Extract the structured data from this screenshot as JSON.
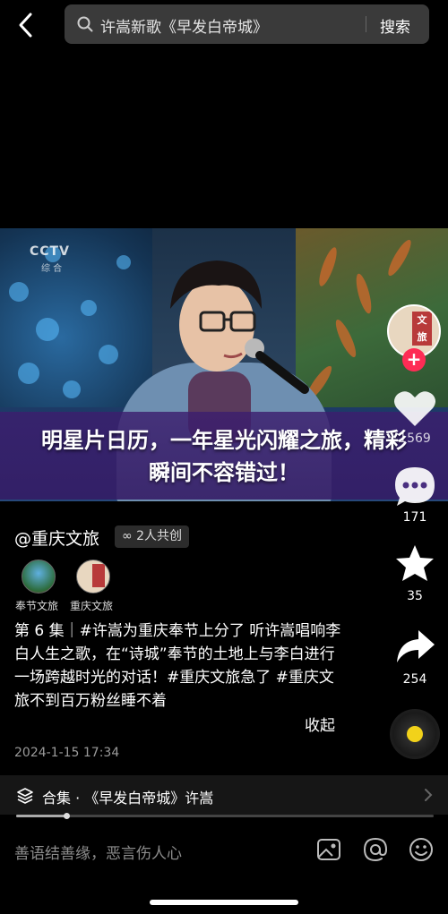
{
  "search": {
    "query": "许嵩新歌《早发白帝城》",
    "submit_label": "搜索"
  },
  "video": {
    "channel_logo": "CCTV",
    "channel_sub": "综 合",
    "banner_text": "明星片日历，一年星光闪耀之旅，精彩瞬间不容错过！"
  },
  "rail": {
    "avatar_badge": [
      "文",
      "旅"
    ],
    "follow_symbol": "+",
    "like_count": "1569",
    "comment_count": "171",
    "favorite_count": "35",
    "share_count": "254"
  },
  "author": {
    "name": "@重庆文旅",
    "cocreate_label": "∞ 2人共创",
    "cocreators": [
      {
        "label": "奉节文旅"
      },
      {
        "label": "重庆文旅"
      }
    ]
  },
  "description": {
    "text": "第 6 集｜#许嵩为重庆奉节上分了 听许嵩唱响李白人生之歌，在“诗城”奉节的土地上与李白进行一场跨越时光的对话！#重庆文旅急了 #重庆文旅不到百万粉丝睡不着",
    "fold_label": "收起",
    "date": "2024-1-15 17:34"
  },
  "collection": {
    "text": "合集 · 《早发白帝城》许嵩",
    "progress": 0.12
  },
  "comment_bar": {
    "placeholder": "善语结善缘，恶言伤人心"
  },
  "colors": {
    "background": "#000000",
    "follow_badge": "#fe2c55",
    "banner": "#3c1e6e",
    "disc_dot": "#f2d21a"
  }
}
